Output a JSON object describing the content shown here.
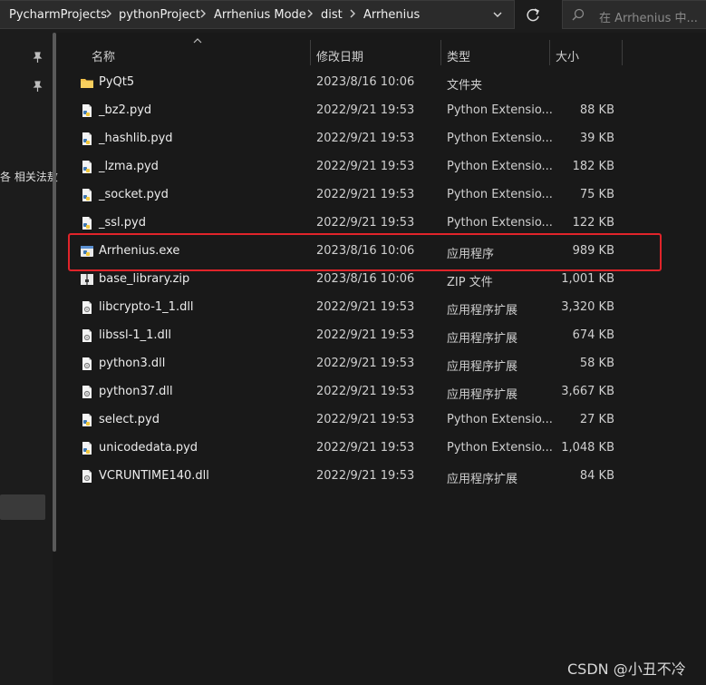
{
  "breadcrumb": [
    "PycharmProjects",
    "pythonProject",
    "Arrhenius Mode",
    "dist",
    "Arrhenius"
  ],
  "search": {
    "placeholder": "在 Arrhenius 中..."
  },
  "nav": {
    "text": "各 相关法敖"
  },
  "columns": {
    "name": "名称",
    "modified": "修改日期",
    "type": "类型",
    "size": "大小"
  },
  "files": [
    {
      "name": "PyQt5",
      "modified": "2023/8/16 10:06",
      "type": "文件夹",
      "size": "",
      "icon": "folder-icon"
    },
    {
      "name": "_bz2.pyd",
      "modified": "2022/9/21 19:53",
      "type": "Python Extensio...",
      "size": "88 KB",
      "icon": "python-file-icon"
    },
    {
      "name": "_hashlib.pyd",
      "modified": "2022/9/21 19:53",
      "type": "Python Extensio...",
      "size": "39 KB",
      "icon": "python-file-icon"
    },
    {
      "name": "_lzma.pyd",
      "modified": "2022/9/21 19:53",
      "type": "Python Extensio...",
      "size": "182 KB",
      "icon": "python-file-icon"
    },
    {
      "name": "_socket.pyd",
      "modified": "2022/9/21 19:53",
      "type": "Python Extensio...",
      "size": "75 KB",
      "icon": "python-file-icon"
    },
    {
      "name": "_ssl.pyd",
      "modified": "2022/9/21 19:53",
      "type": "Python Extensio...",
      "size": "122 KB",
      "icon": "python-file-icon"
    },
    {
      "name": "Arrhenius.exe",
      "modified": "2023/8/16 10:06",
      "type": "应用程序",
      "size": "989 KB",
      "icon": "exe-file-icon"
    },
    {
      "name": "base_library.zip",
      "modified": "2023/8/16 10:06",
      "type": "ZIP 文件",
      "size": "1,001 KB",
      "icon": "zip-file-icon"
    },
    {
      "name": "libcrypto-1_1.dll",
      "modified": "2022/9/21 19:53",
      "type": "应用程序扩展",
      "size": "3,320 KB",
      "icon": "dll-file-icon"
    },
    {
      "name": "libssl-1_1.dll",
      "modified": "2022/9/21 19:53",
      "type": "应用程序扩展",
      "size": "674 KB",
      "icon": "dll-file-icon"
    },
    {
      "name": "python3.dll",
      "modified": "2022/9/21 19:53",
      "type": "应用程序扩展",
      "size": "58 KB",
      "icon": "dll-file-icon"
    },
    {
      "name": "python37.dll",
      "modified": "2022/9/21 19:53",
      "type": "应用程序扩展",
      "size": "3,667 KB",
      "icon": "dll-file-icon"
    },
    {
      "name": "select.pyd",
      "modified": "2022/9/21 19:53",
      "type": "Python Extensio...",
      "size": "27 KB",
      "icon": "python-file-icon"
    },
    {
      "name": "unicodedata.pyd",
      "modified": "2022/9/21 19:53",
      "type": "Python Extensio...",
      "size": "1,048 KB",
      "icon": "python-file-icon"
    },
    {
      "name": "VCRUNTIME140.dll",
      "modified": "2022/9/21 19:53",
      "type": "应用程序扩展",
      "size": "84 KB",
      "icon": "dll-file-icon"
    }
  ],
  "watermark": "CSDN @小丑不冷",
  "colors": {
    "background": "#191919",
    "highlight": "#e0242a",
    "folder": "#f3c04a"
  }
}
